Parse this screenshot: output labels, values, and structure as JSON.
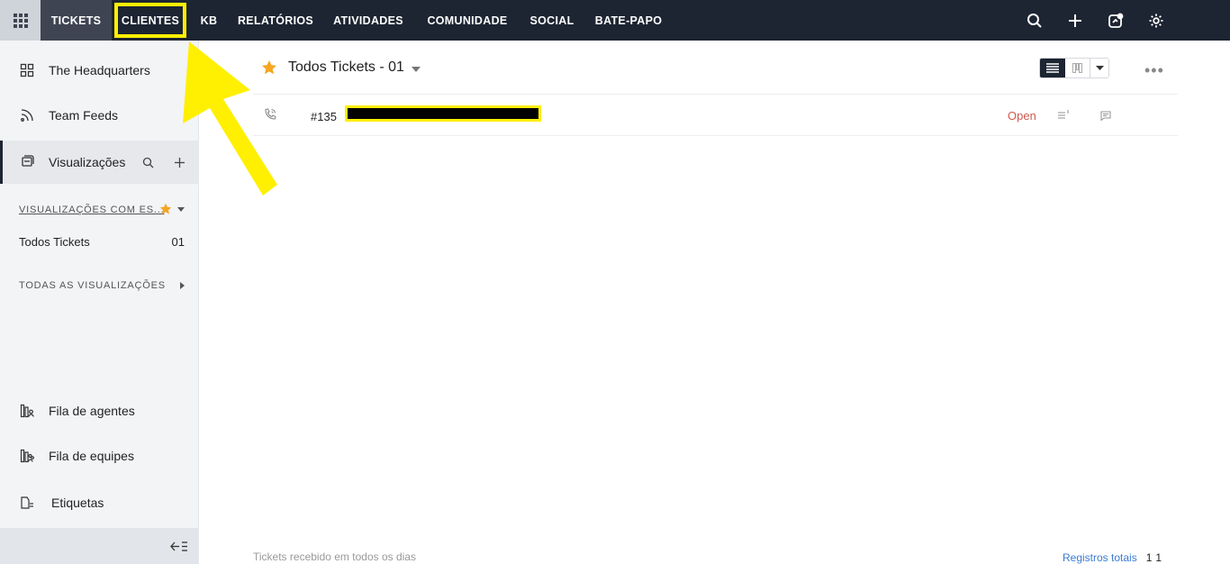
{
  "nav": {
    "items": [
      "TICKETS",
      "CLIENTES",
      "KB",
      "RELATÓRIOS",
      "ATIVIDADES",
      "COMUNIDADE",
      "SOCIAL",
      "BATE-PAPO"
    ]
  },
  "sidebar": {
    "headquarters": "The Headquarters",
    "team_feeds": "Team Feeds",
    "visualizacoes": "Visualizações",
    "section_starred": "VISUALIZAÇÕES COM ES...",
    "view_name": "Todos Tickets",
    "view_count": "01",
    "section_all": "TODAS AS VISUALIZAÇÕES",
    "agent_queue": "Fila de agentes",
    "team_queue": "Fila de equipes",
    "tags": "Etiquetas"
  },
  "main": {
    "title": "Todos Tickets - 01",
    "ticket": {
      "id": "#135",
      "status": "Open"
    },
    "footer_left": "Tickets recebido em todos os dias",
    "footer_total_label": "Registros totais",
    "footer_total_a": "1",
    "footer_total_b": "1"
  },
  "colors": {
    "topbar": "#1d2432",
    "highlight": "#ffef00",
    "star": "#f5a623",
    "status_open": "#d0584e",
    "link": "#3a7bd5"
  }
}
